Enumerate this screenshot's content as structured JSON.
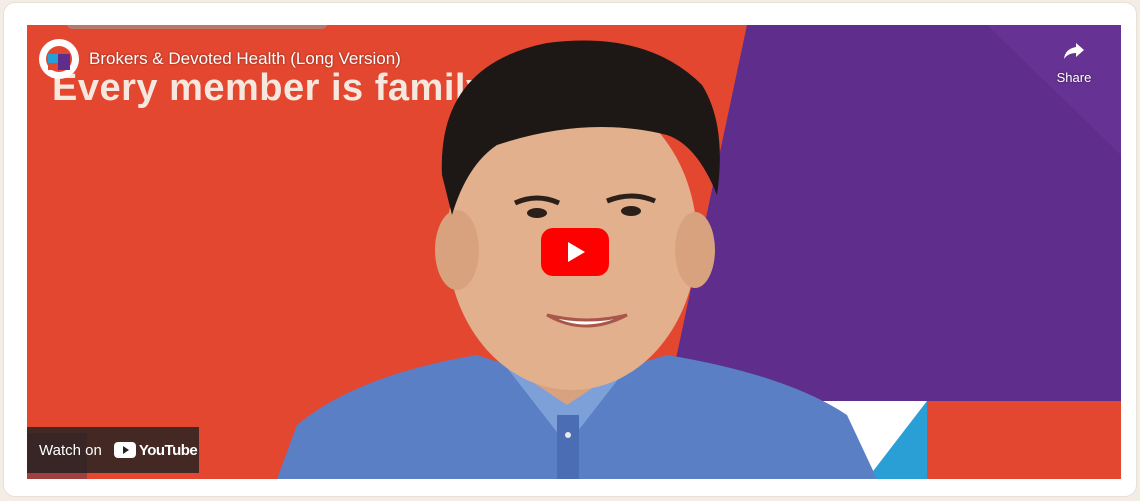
{
  "video": {
    "title": "Brokers & Devoted Health (Long Version)",
    "headline_text": "Every member is family",
    "share_label": "Share",
    "watch_on_label": "Watch on",
    "youtube_word": "YouTube"
  },
  "colors": {
    "page_background": "#f4ede6",
    "video_orange": "#e4472f",
    "video_purple": "#5f2e8c",
    "youtube_red": "#ff0000"
  },
  "icons": {
    "channel": "devoted-health-logo-icon",
    "share": "share-arrow-icon",
    "play": "youtube-play-icon",
    "youtube": "youtube-logo-icon"
  }
}
